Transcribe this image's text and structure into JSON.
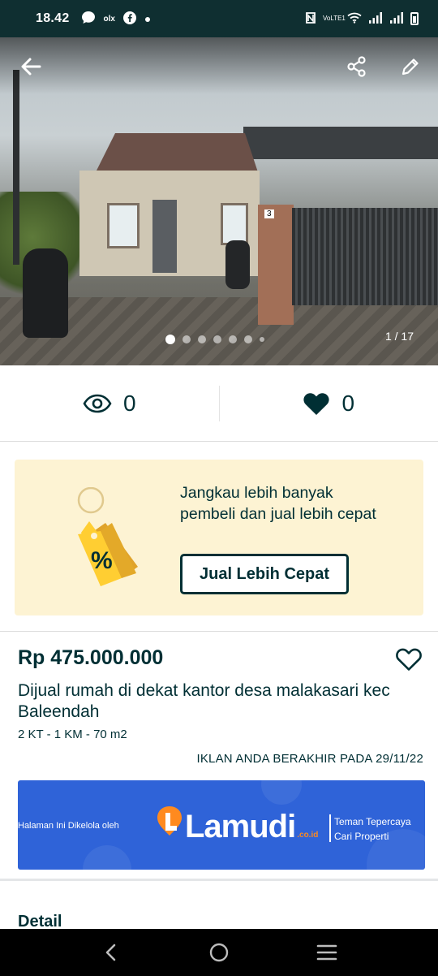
{
  "status_bar": {
    "time": "18.42",
    "left_icons": [
      "chat-icon",
      "olx-icon",
      "facebook-icon",
      "dot-icon"
    ],
    "right_icons": [
      "nfc-icon",
      "volte-icon",
      "wifi-icon",
      "signal-icon",
      "signal-icon",
      "battery-icon"
    ],
    "olx_label": "olx",
    "volte_label": "VoLTE1"
  },
  "hero": {
    "counter": "1 / 17",
    "dots_count": 6,
    "active_dot": 0,
    "house_number": "3"
  },
  "stats": {
    "views": "0",
    "favorites": "0"
  },
  "promo": {
    "text": "Jangkau lebih banyak pembeli dan jual lebih cepat",
    "button_label": "Jual Lebih Cepat",
    "tag_symbol": "%"
  },
  "listing": {
    "price": "Rp 475.000.000",
    "title": "Dijual rumah di dekat kantor desa malakasari kec Baleendah",
    "specs": "2 KT - 1 KM - 70 m2",
    "expiry": "IKLAN ANDA BERAKHIR PADA 29/11/22"
  },
  "banner": {
    "managed_by": "Halaman Ini Dikelola oleh",
    "brand": "Lamudi",
    "brand_suffix": ".co.id",
    "tagline_line1": "Teman Tepercaya",
    "tagline_line2": "Cari Properti"
  },
  "details": {
    "heading": "Detail"
  },
  "colors": {
    "primary_text": "#002f34",
    "status_bar": "#0f2f31",
    "promo_bg": "#fdf3d3",
    "tag_yellow": "#ffce32",
    "banner_blue": "#2f63d8",
    "brand_orange": "#ff8a1f"
  }
}
